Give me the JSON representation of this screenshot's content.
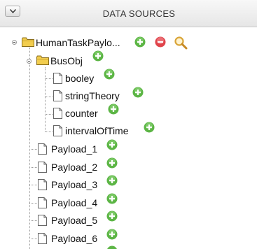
{
  "panel": {
    "title": "DATA SOURCES",
    "collapse_icon": "chevron-down-icon"
  },
  "tree": {
    "root": {
      "label": "HumanTaskPaylo...",
      "icon": "folder-icon",
      "actions": [
        "add-icon",
        "remove-icon",
        "search-icon"
      ]
    },
    "busobj": {
      "label": "BusObj",
      "icon": "folder-icon",
      "action": "add-icon",
      "children": [
        {
          "label": "booley",
          "icon": "document-icon",
          "action": "add-icon"
        },
        {
          "label": "stringTheory",
          "icon": "document-icon",
          "action": "add-icon"
        },
        {
          "label": "counter",
          "icon": "document-icon",
          "action": "add-icon"
        },
        {
          "label": "intervalOfTime",
          "icon": "document-icon",
          "action": "add-icon"
        }
      ]
    },
    "payloads": [
      {
        "label": "Payload_1",
        "icon": "document-icon",
        "action": "add-icon"
      },
      {
        "label": "Payload_2",
        "icon": "document-icon",
        "action": "add-icon"
      },
      {
        "label": "Payload_3",
        "icon": "document-icon",
        "action": "add-icon"
      },
      {
        "label": "Payload_4",
        "icon": "document-icon",
        "action": "add-icon"
      },
      {
        "label": "Payload_5",
        "icon": "document-icon",
        "action": "add-icon"
      },
      {
        "label": "Payload_6",
        "icon": "document-icon",
        "action": "add-icon"
      }
    ]
  },
  "colors": {
    "add": "#5cb545",
    "remove": "#e0444b",
    "search": "#d9a437",
    "folder": "#f2cd4e",
    "connector": "#999999"
  }
}
